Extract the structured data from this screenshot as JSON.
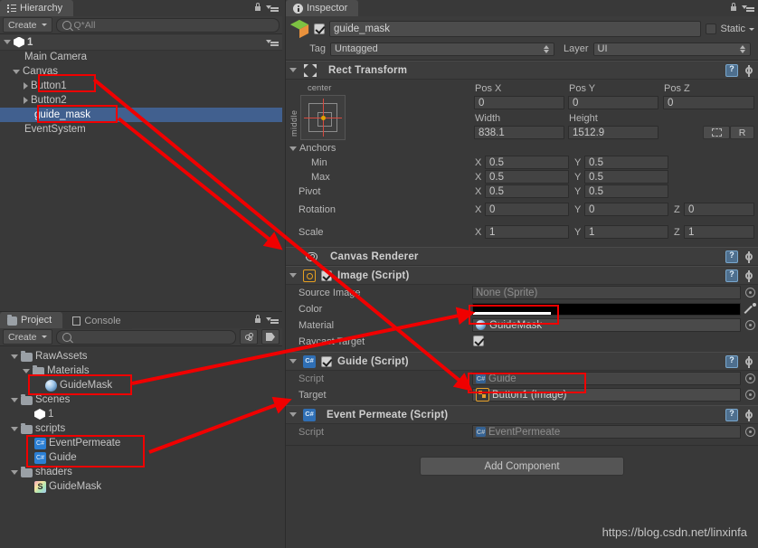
{
  "hierarchy": {
    "tab_label": "Hierarchy",
    "create_label": "Create",
    "search_placeholder": "Q*All",
    "scene_name": "1",
    "items": [
      {
        "label": "Main Camera",
        "depth": 2,
        "arrow": "none",
        "icon": "camera-icon"
      },
      {
        "label": "Canvas",
        "depth": 1,
        "arrow": "open",
        "icon": "none"
      },
      {
        "label": "Button1",
        "depth": 2,
        "arrow": "closed",
        "icon": "none"
      },
      {
        "label": "Button2",
        "depth": 2,
        "arrow": "closed",
        "icon": "none"
      },
      {
        "label": "guide_mask",
        "depth": 2,
        "arrow": "none",
        "icon": "none",
        "selected": true
      },
      {
        "label": "EventSystem",
        "depth": 1,
        "arrow": "none",
        "icon": "none"
      }
    ]
  },
  "project": {
    "tab_label": "Project",
    "console_tab_label": "Console",
    "create_label": "Create",
    "search_placeholder": "",
    "items": [
      {
        "label": "RawAssets",
        "depth": 0,
        "arrow": "open",
        "icon": "folder-icon"
      },
      {
        "label": "Materials",
        "depth": 1,
        "arrow": "open",
        "icon": "folder-icon"
      },
      {
        "label": "GuideMask",
        "depth": 2,
        "arrow": "none",
        "icon": "material-icon"
      },
      {
        "label": "Scenes",
        "depth": 0,
        "arrow": "open",
        "icon": "folder-icon"
      },
      {
        "label": "1",
        "depth": 1,
        "arrow": "none",
        "icon": "unity-icon"
      },
      {
        "label": "scripts",
        "depth": 0,
        "arrow": "open",
        "icon": "folder-icon"
      },
      {
        "label": "EventPermeate",
        "depth": 1,
        "arrow": "none",
        "icon": "csharp-icon"
      },
      {
        "label": "Guide",
        "depth": 1,
        "arrow": "none",
        "icon": "csharp-icon"
      },
      {
        "label": "shaders",
        "depth": 0,
        "arrow": "open",
        "icon": "folder-icon"
      },
      {
        "label": "GuideMask",
        "depth": 1,
        "arrow": "none",
        "icon": "shader-icon"
      }
    ]
  },
  "inspector": {
    "tab_label": "Inspector",
    "object_name": "guide_mask",
    "object_enabled": true,
    "static_label": "Static",
    "tag_label": "Tag",
    "tag_value": "Untagged",
    "layer_label": "Layer",
    "layer_value": "UI",
    "rect_transform": {
      "title": "Rect Transform",
      "anchor_preset_top": "center",
      "anchor_preset_side": "middle",
      "pos_x_label": "Pos X",
      "pos_y_label": "Pos Y",
      "pos_z_label": "Pos Z",
      "pos_x": "0",
      "pos_y": "0",
      "pos_z": "0",
      "width_label": "Width",
      "height_label": "Height",
      "width": "838.1",
      "height": "1512.9",
      "blueprint_label": "",
      "raw_label": "R",
      "anchors_label": "Anchors",
      "min_label": "Min",
      "max_label": "Max",
      "pivot_label": "Pivot",
      "min_x": "0.5",
      "min_y": "0.5",
      "max_x": "0.5",
      "max_y": "0.5",
      "pivot_x": "0.5",
      "pivot_y": "0.5",
      "rotation_label": "Rotation",
      "rot_x": "0",
      "rot_y": "0",
      "rot_z": "0",
      "scale_label": "Scale",
      "scale_x": "1",
      "scale_y": "1",
      "scale_z": "1",
      "axis_x": "X",
      "axis_y": "Y",
      "axis_z": "Z"
    },
    "canvas_renderer": {
      "title": "Canvas Renderer"
    },
    "image": {
      "title": "Image (Script)",
      "enabled": true,
      "source_image_label": "Source Image",
      "source_image_value": "None (Sprite)",
      "color_label": "Color",
      "color_value": "#000000",
      "color_alpha_percent": 29,
      "material_label": "Material",
      "material_value": "GuideMask",
      "raycast_label": "Raycast Target",
      "raycast_checked": true
    },
    "guide": {
      "title": "Guide (Script)",
      "enabled": true,
      "script_label": "Script",
      "script_value": "Guide",
      "target_label": "Target",
      "target_value": "Button1 (Image)"
    },
    "event_permeate": {
      "title": "Event Permeate (Script)",
      "script_label": "Script",
      "script_value": "EventPermeate"
    },
    "add_component_label": "Add Component"
  },
  "watermark": "https://blog.csdn.net/linxinfa",
  "colors": {
    "background": "#393939",
    "panel_header": "#3c3c3c",
    "selection_blue": "#41608f",
    "annotation_red": "#f00000",
    "text": "#b7b7b7"
  }
}
